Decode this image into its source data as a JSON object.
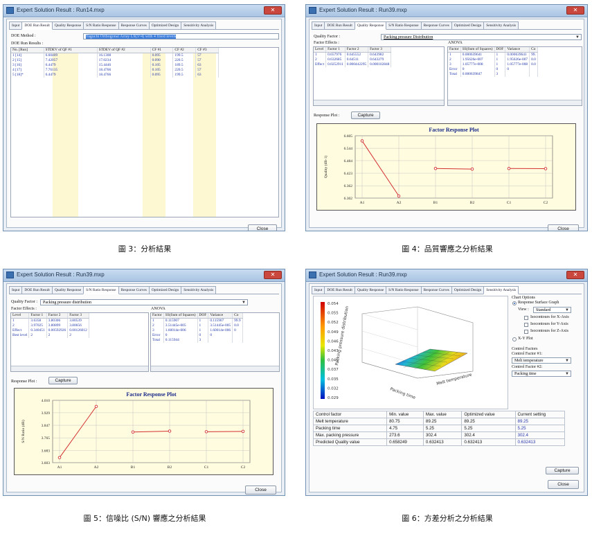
{
  "colors": {
    "accent_line": "#d32f2f",
    "titlebar": "#b8cfe8",
    "plot_bg": "#fffce0"
  },
  "windows": [
    {
      "title": "Expert Solution Result : Run14.mxp",
      "caption": "圖 3：分析結果",
      "tabs": [
        "Input",
        "DOE Run Result",
        "Quality Response",
        "S/N Ratio Response",
        "Response Curves",
        "Optimized Design",
        "Sensitivity Analysis"
      ],
      "active_tab": 1,
      "doe_method_label": "DOE Method :",
      "doe_method_value": "Taguchi Orthogonal Array L9(3^4) with 4 fixed levels",
      "doe_results_label": "DOE Run Results :",
      "columns": [
        "No. [Run]",
        "STDEV of QF #1",
        "STDEV of QF #2",
        "CF #1",
        "CF #2",
        "CF #3"
      ],
      "rows": [
        [
          "1 [14]",
          "6.60409",
          "16.1308",
          "0.095",
          "199.5",
          "57"
        ],
        [
          "2 [15]",
          "7.42057",
          "17.0234",
          "0.090",
          "220.5",
          "57"
        ],
        [
          "3 [16]",
          "6.4479",
          "15.4446",
          "0.105",
          "189.5",
          "63"
        ],
        [
          "4 [17]",
          "7.76135",
          "18.4766",
          "0.105",
          "220.5",
          "57"
        ],
        [
          "5 [18]*",
          "6.4479",
          "18.4766",
          "0.095",
          "199.5",
          "63"
        ]
      ],
      "close_label": "Close"
    },
    {
      "title": "Expert Solution Result : Run39.mxp",
      "caption": "圖 4：品質響應之分析結果",
      "tabs": [
        "Input",
        "DOE Run Result",
        "Quality Response",
        "S/N Ratio Response",
        "Response Curves",
        "Optimized Design",
        "Sensitivity Analysis"
      ],
      "active_tab": 2,
      "quality_factor_label": "Quality Factor :",
      "quality_factor_value": "Packing pressure Distribution",
      "factor_effects_label": "Factor Effects :",
      "anova_label": "ANOVA",
      "effects_columns": [
        "Level",
        "Factor 1",
        "Factor 2",
        "Factor 3"
      ],
      "effects_rows": [
        [
          "1",
          "0.657976",
          "0.645552",
          "0.643982"
        ],
        [
          "2",
          "0.632685",
          "0.64511",
          "0.643279"
        ],
        [
          "Effect",
          "0.0252911",
          "0.000442295",
          "0.000102848"
        ]
      ],
      "anova_columns": [
        "Factor",
        "SS(Sum of Squares)",
        "DOF",
        "Variance",
        "Co"
      ],
      "anova_rows": [
        [
          "1",
          "0.000639641",
          "1",
          "0.000639641",
          "99."
        ],
        [
          "2",
          "1.95626e-007",
          "1",
          "1.95626e-007",
          "0.0"
        ],
        [
          "3",
          "1.05777e-008",
          "1",
          "1.05777e-008",
          "0.0"
        ],
        [
          "Error",
          "0",
          "0",
          "0",
          ""
        ],
        [
          "Total",
          "0.000639847",
          "3",
          "",
          ""
        ]
      ],
      "response_plot_label": "Response Plot :",
      "capture_label": "Capture",
      "close_label": "Close"
    },
    {
      "title": "Expert Solution Result : Run39.mxp",
      "caption": "圖 5：信噪比 (S/N) 響應之分析結果",
      "tabs": [
        "Input",
        "DOE Run Result",
        "Quality Response",
        "S/N Ratio Response",
        "Response Curves",
        "Optimized Design",
        "Sensitivity Analysis"
      ],
      "active_tab": 3,
      "quality_factor_label": "Quality Factor :",
      "quality_factor_value": "Packing pressure distribution",
      "factor_effects_label": "Factor Effects :",
      "anova_label": "ANOVA",
      "effects_columns": [
        "Level",
        "Factor 1",
        "Factor 2",
        "Factor 3"
      ],
      "effects_rows": [
        [
          "1",
          "3.6358",
          "3.80306",
          "3.80539"
        ],
        [
          "2",
          "3.97025",
          "3.80899",
          "3.80656"
        ],
        [
          "Effect",
          "0.340451",
          "0.00592926",
          "0.00126012"
        ],
        [
          "Best level",
          "2",
          "2",
          "2"
        ]
      ],
      "anova_columns": [
        "Factor",
        "SS(Sum of Squares)",
        "DOF",
        "Variance",
        "Co"
      ],
      "anova_rows": [
        [
          "1",
          "0.115907",
          "1",
          "0.115907",
          "99.9"
        ],
        [
          "2",
          "3.51445e-005",
          "1",
          "3.51445e-005",
          "0.0"
        ],
        [
          "3",
          "1.60014e-006",
          "1",
          "1.60014e-006",
          "0"
        ],
        [
          "Error",
          "0",
          "0",
          "0",
          ""
        ],
        [
          "Total",
          "0.115944",
          "3",
          "",
          ""
        ]
      ],
      "response_plot_label": "Response Plot :",
      "capture_label": "Capture",
      "close_label": "Close"
    },
    {
      "title": "Expert Solution Result : Run39.mxp",
      "caption": "圖 6：方差分析之分析結果",
      "tabs": [
        "Input",
        "DOE Run Result",
        "Quality Response",
        "S/N Ratio Response",
        "Response Curves",
        "Optimized Design",
        "Sensitivity Analysis"
      ],
      "active_tab": 6,
      "chart_options_label": "Chart Options",
      "response_surface_label": "Response Surface Graph",
      "view_label": "View :",
      "view_value": "Standard",
      "checkboxes": [
        "Isocontours for X-Axis",
        "Isocontours for Y-Axis",
        "Isocontours for Z-Axis"
      ],
      "xy_plot_label": "X-Y Plot",
      "control_factors_label": "Control Factors",
      "control_factor1_label": "Control Factor #1:",
      "control_factor1_value": "Melt temperature",
      "control_factor2_label": "Control Factor #2:",
      "control_factor2_value": "Packing time",
      "colorbar_ticks": [
        "0.054",
        "0.055",
        "0.052",
        "0.049",
        "0.046",
        "0.043",
        "0.040",
        "0.037",
        "0.035",
        "0.032",
        "0.029"
      ],
      "surface_zlabel": "Packing pressure distribution",
      "surface_xlabel": "Packing time",
      "surface_ylabel": "Melt temperature",
      "table_columns": [
        "Control factor",
        "Min. value",
        "Max. value",
        "Optimized value",
        "Current setting"
      ],
      "table_rows": [
        [
          "Melt temperature",
          "80.75",
          "89.25",
          "89.25",
          "89.25"
        ],
        [
          "Packing time",
          "4.75",
          "5.25",
          "5.25",
          "5.25"
        ],
        [
          "Max. packing pressure",
          "273.6",
          "302.4",
          "302.4",
          "302.4"
        ],
        [
          "Predicted Quality value",
          "0.658249",
          "0.632413",
          "0.632413",
          "0.632413"
        ]
      ],
      "capture_label": "Capture",
      "close_label": "Close"
    }
  ],
  "chart_data": [
    {
      "type": "line",
      "title": "Factor Response Plot",
      "xlabel": "",
      "ylabel": "Quality (dB-1)",
      "categories": [
        "A1",
        "A2",
        "B1",
        "B2",
        "C1",
        "C2"
      ],
      "yticks": [
        "6.605",
        "6.544",
        "6.484",
        "6.423",
        "6.362",
        "6.302"
      ],
      "ylim": [
        6.302,
        6.605
      ],
      "series": [
        {
          "x": [
            "A1",
            "A2"
          ],
          "values": [
            6.58,
            6.312
          ]
        },
        {
          "x": [
            "B1",
            "B2"
          ],
          "values": [
            6.446,
            6.443
          ]
        },
        {
          "x": [
            "C1",
            "C2"
          ],
          "values": [
            6.446,
            6.445
          ]
        }
      ],
      "grid": true
    },
    {
      "type": "line",
      "title": "Factor Response Plot",
      "xlabel": "",
      "ylabel": "S/N Ratio (dB)",
      "categories": [
        "A1",
        "A2",
        "B1",
        "B2",
        "C1",
        "C2"
      ],
      "yticks": [
        "4.010",
        "3.929",
        "3.847",
        "3.765",
        "3.683",
        "3.603"
      ],
      "ylim": [
        3.603,
        4.01
      ],
      "series": [
        {
          "x": [
            "A1",
            "A2"
          ],
          "values": [
            3.636,
            3.97
          ]
        },
        {
          "x": [
            "B1",
            "B2"
          ],
          "values": [
            3.803,
            3.809
          ]
        },
        {
          "x": [
            "C1",
            "C2"
          ],
          "values": [
            3.805,
            3.807
          ]
        }
      ],
      "grid": true
    }
  ]
}
